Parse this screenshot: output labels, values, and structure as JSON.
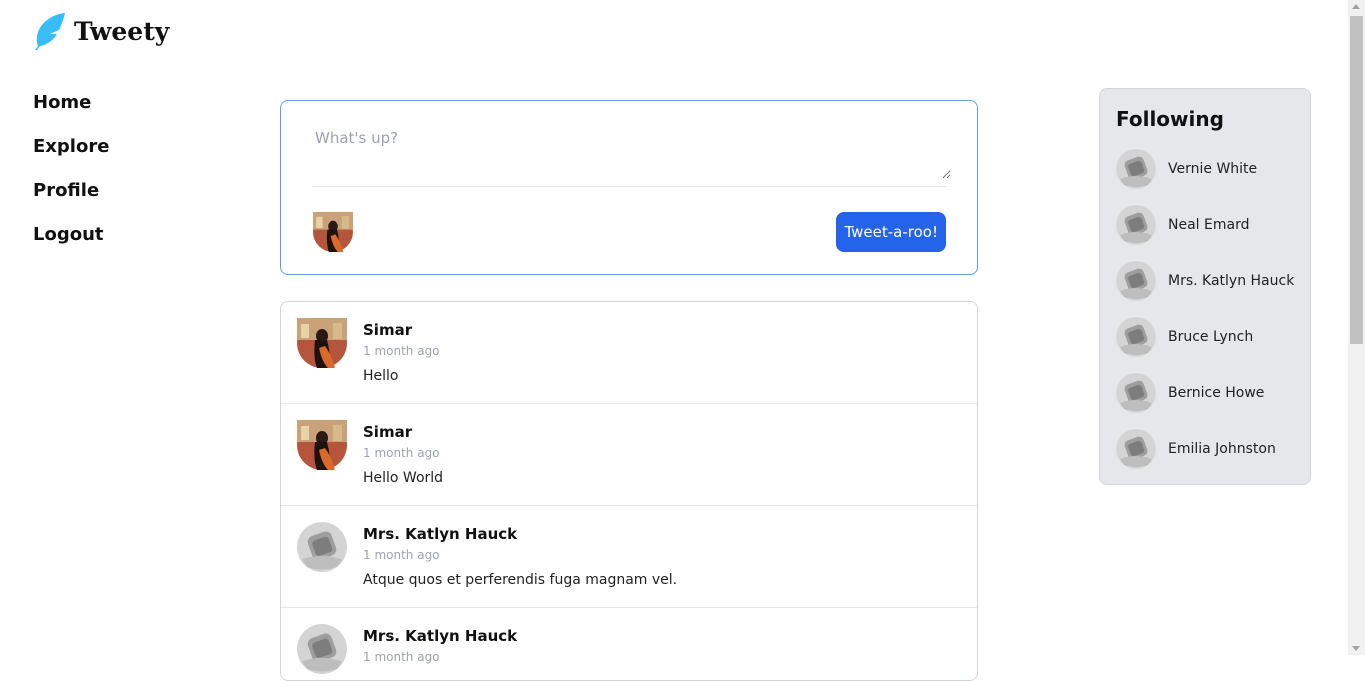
{
  "brand": {
    "name": "Tweety",
    "icon": "feather-icon",
    "color": "#38bdf8"
  },
  "nav": [
    {
      "label": "Home"
    },
    {
      "label": "Explore"
    },
    {
      "label": "Profile"
    },
    {
      "label": "Logout"
    }
  ],
  "composer": {
    "placeholder": "What's up?",
    "value": "",
    "button_label": "Tweet-a-roo!",
    "accent": "#2563eb"
  },
  "timeline": [
    {
      "name": "Simar",
      "time": "1 month ago",
      "body": "Hello",
      "avatar": "photo"
    },
    {
      "name": "Simar",
      "time": "1 month ago",
      "body": "Hello World",
      "avatar": "photo"
    },
    {
      "name": "Mrs. Katlyn Hauck",
      "time": "1 month ago",
      "body": "Atque quos et perferendis fuga magnam vel.",
      "avatar": "default"
    },
    {
      "name": "Mrs. Katlyn Hauck",
      "time": "1 month ago",
      "body": "",
      "avatar": "default"
    }
  ],
  "following": {
    "title": "Following",
    "users": [
      {
        "name": "Vernie White"
      },
      {
        "name": "Neal Emard"
      },
      {
        "name": "Mrs. Katlyn Hauck"
      },
      {
        "name": "Bruce Lynch"
      },
      {
        "name": "Bernice Howe"
      },
      {
        "name": "Emilia Johnston"
      }
    ]
  }
}
